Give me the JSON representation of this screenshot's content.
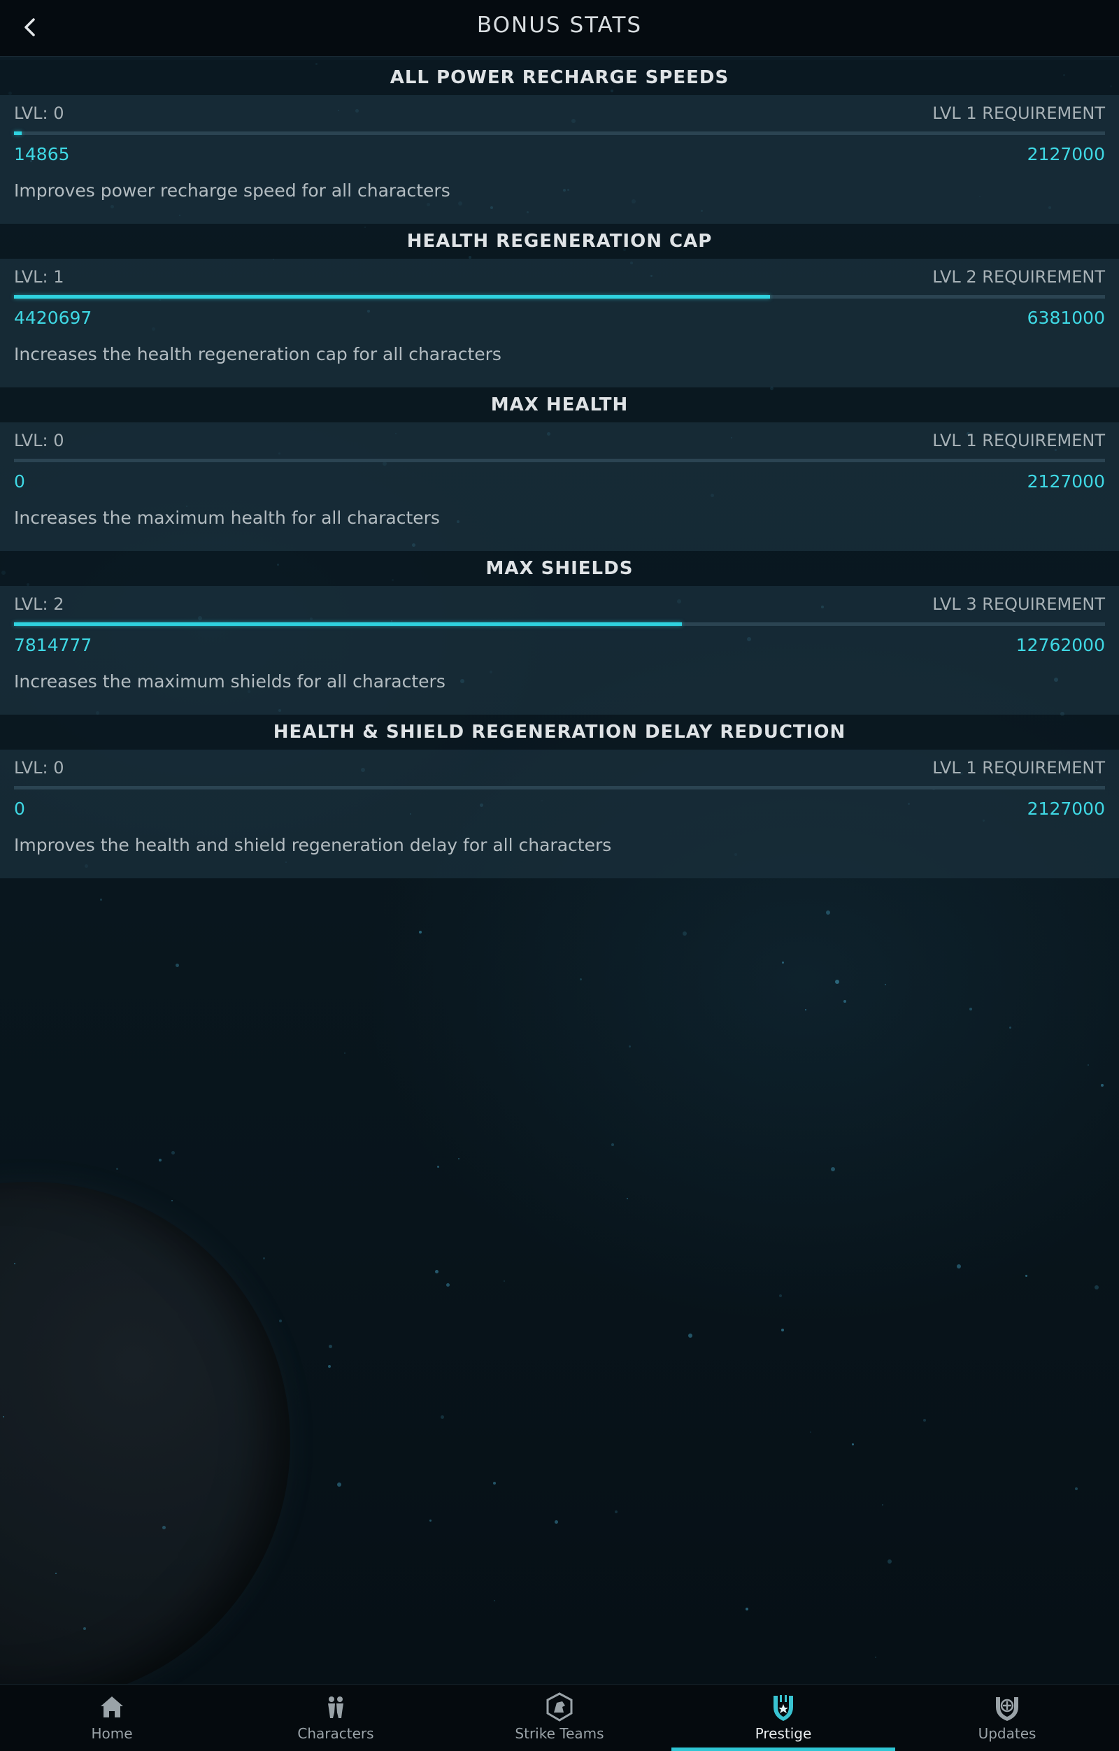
{
  "header": {
    "title": "BONUS STATS",
    "back_icon": "chevron-left-icon"
  },
  "stats": [
    {
      "title": "ALL POWER RECHARGE SPEEDS",
      "level": "LVL: 0",
      "requirement": "LVL 1 REQUIREMENT",
      "current": "14865",
      "target": "2127000",
      "progress": 0.007,
      "description": "Improves power recharge speed for all characters"
    },
    {
      "title": "HEALTH REGENERATION CAP",
      "level": "LVL: 1",
      "requirement": "LVL 2 REQUIREMENT",
      "current": "4420697",
      "target": "6381000",
      "progress": 0.693,
      "description": "Increases the health regeneration cap for all characters"
    },
    {
      "title": "MAX HEALTH",
      "level": "LVL: 0",
      "requirement": "LVL 1 REQUIREMENT",
      "current": "0",
      "target": "2127000",
      "progress": 0,
      "description": "Increases the maximum health for all characters"
    },
    {
      "title": "MAX SHIELDS",
      "level": "LVL: 2",
      "requirement": "LVL 3 REQUIREMENT",
      "current": "7814777",
      "target": "12762000",
      "progress": 0.612,
      "description": "Increases the maximum shields for all characters"
    },
    {
      "title": "HEALTH & SHIELD REGENERATION DELAY REDUCTION",
      "level": "LVL: 0",
      "requirement": "LVL 1 REQUIREMENT",
      "current": "0",
      "target": "2127000",
      "progress": 0,
      "description": "Improves the health and shield regeneration delay for all characters"
    }
  ],
  "nav": {
    "items": [
      {
        "label": "Home",
        "icon": "home-icon",
        "active": false
      },
      {
        "label": "Characters",
        "icon": "characters-icon",
        "active": false
      },
      {
        "label": "Strike Teams",
        "icon": "strike-teams-icon",
        "active": false
      },
      {
        "label": "Prestige",
        "icon": "prestige-icon",
        "active": true
      },
      {
        "label": "Updates",
        "icon": "updates-icon",
        "active": false
      }
    ]
  },
  "colors": {
    "accent": "#2fd3e0",
    "value_text": "#3fd8e4",
    "header_bg": "#050b10"
  }
}
